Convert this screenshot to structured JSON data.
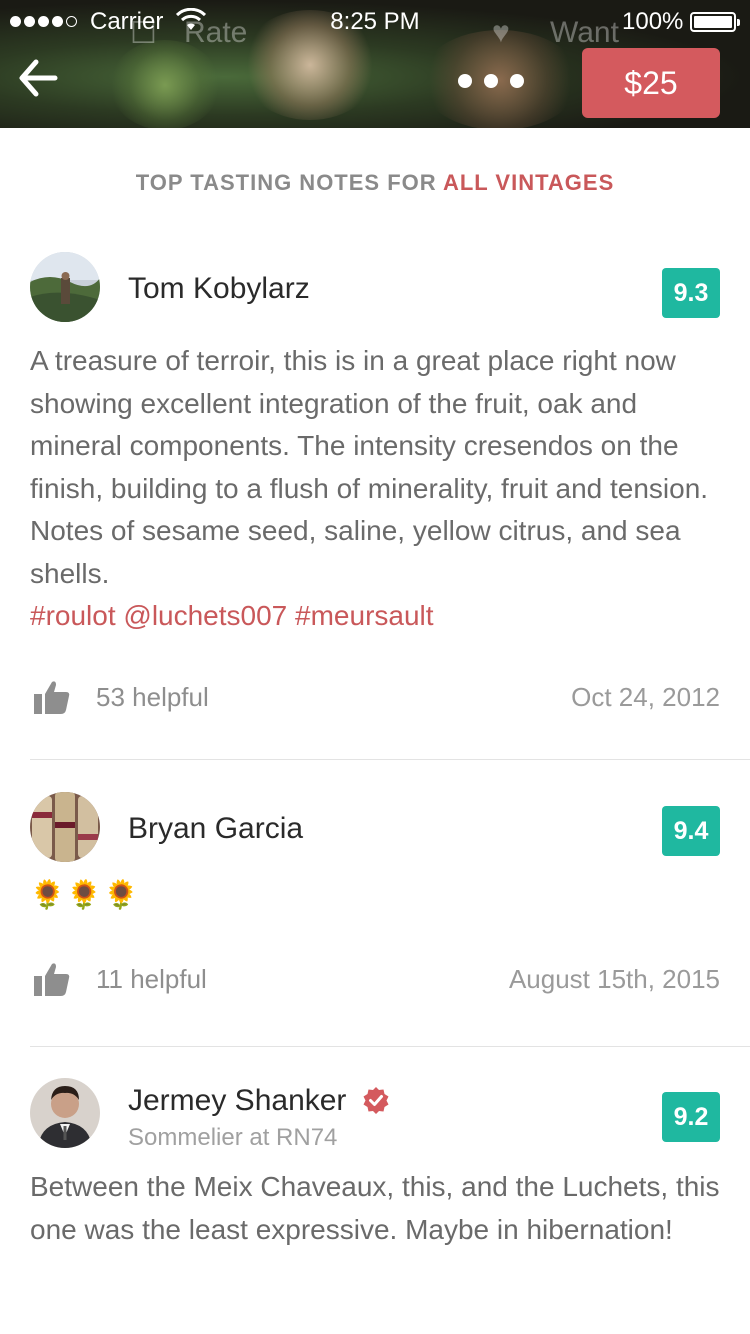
{
  "status_bar": {
    "carrier": "Carrier",
    "time": "8:25 PM",
    "battery": "100%"
  },
  "hero": {
    "ghost_rate": "Rate",
    "ghost_want": "Want"
  },
  "header": {
    "price": "$25"
  },
  "section": {
    "title_prefix": "TOP TASTING NOTES FOR ",
    "title_accent": "ALL VINTAGES"
  },
  "reviews": [
    {
      "name": "Tom Kobylarz",
      "score": "9.3",
      "text": "A treasure of terroir, this is in a great place right now showing excellent integration of the fruit, oak and mineral components. The intensity cresendos on the finish, building to a flush of minerality, fruit and tension. Notes of sesame seed, saline, yellow citrus, and sea shells.",
      "tags": "#roulot @luchets007 #meursault",
      "helpful": "53 helpful",
      "date": "Oct 24, 2012"
    },
    {
      "name": "Bryan Garcia",
      "score": "9.4",
      "text": "🌻🌻🌻",
      "helpful": "11 helpful",
      "date": "August 15th, 2015"
    },
    {
      "name": "Jermey Shanker",
      "role": "Sommelier at RN74",
      "score": "9.2",
      "text": "Between the Meix Chaveaux, this, and the Luchets, this one was the least expressive. Maybe in hibernation!"
    }
  ],
  "colors": {
    "accent": "#d45a5e",
    "score": "#1fb8a0"
  }
}
